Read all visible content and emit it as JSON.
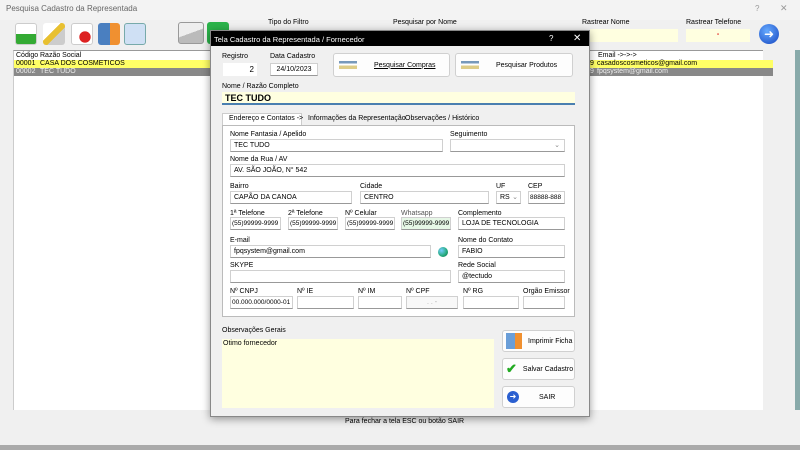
{
  "main_window": {
    "title": "Pesquisa Cadastro da Representada",
    "help": "?",
    "close": "✕",
    "filter_label": "Tipo do Filtro",
    "search_name_label": "Pesquisar por Nome",
    "track_name_label": "Rastrear Nome",
    "track_phone_label": "Rastrear Telefone",
    "track_phone_value": "-",
    "toolbar": [
      "add-icon",
      "edit-icon",
      "delete-icon",
      "print-icon",
      "printer-icon",
      "email-icon",
      "whatsapp-icon"
    ],
    "list": {
      "headers": {
        "code": "Código",
        "name": "Razão Social",
        "email": "Email ->->->"
      },
      "rows": [
        {
          "code": "00001",
          "name": "CASA DOS COSMETICOS",
          "tail": "9",
          "email": "casadoscosmeticos@gmail.com"
        },
        {
          "code": "00002",
          "name": "TEC TUDO",
          "tail": "9",
          "email": "fpqsystem@gmail.com"
        }
      ]
    },
    "footer": "Para fechar a tela ESC ou botão SAIR"
  },
  "dialog": {
    "title": "Tela Cadastro da Representada / Fornecedor",
    "help": "?",
    "close": "✕",
    "registro_label": "Registro",
    "registro": "2",
    "data_label": "Data Cadastro",
    "data": "24/10/2023",
    "btn_compras": "Pesquisar Compras",
    "btn_produtos": "Pesquisar Produtos",
    "nome_label": "Nome / Razão Completo",
    "nome": "TEC TUDO",
    "tabs": [
      "Endereço e Contatos ->",
      "Informações da Representação",
      "Observações / Histórico"
    ],
    "fields": {
      "fantasia_label": "Nome Fantasia / Apelido",
      "fantasia": "TEC TUDO",
      "seguimento_label": "Seguimento",
      "seguimento": "",
      "rua_label": "Nome da Rua / AV",
      "rua": "AV. SÃO JOÃO, N° 542",
      "bairro_label": "Bairro",
      "bairro": "CAPÃO DA CANOA",
      "cidade_label": "Cidade",
      "cidade": "CENTRO",
      "uf_label": "UF",
      "uf": "RS",
      "cep_label": "CEP",
      "cep": "88888-888",
      "tel1_label": "1ª Telefone",
      "tel1": "(55)99999-9999",
      "tel2_label": "2ª Telefone",
      "tel2": "(55)99999-9999",
      "cel_label": "Nº Celular",
      "cel": "(55)99999-9999",
      "whats_label": "Whatsapp",
      "whats": "(55)99999-9999",
      "compl_label": "Complemento",
      "compl": "LOJA DE TECNOLOGIA",
      "email_label": "E-mail",
      "email": "fpqsystem@gmail.com",
      "contato_label": "Nome do Contato",
      "contato": "FABIO",
      "skype_label": "SKYPE",
      "skype": "",
      "rede_label": "Rede Social",
      "rede": "@tectudo",
      "cnpj_label": "Nº CNPJ",
      "cnpj": "00.000.000/0000-01",
      "ie_label": "Nº IE",
      "ie": "",
      "im_label": "Nº IM",
      "im": "",
      "cpf_label": "Nº CPF",
      "cpf": " .   .   -",
      "rg_label": "Nº RG",
      "rg": "",
      "orgao_label": "Orgão Emissor",
      "orgao": ""
    },
    "obs_label": "Observações Gerais",
    "obs": "Otimo fornecedor",
    "btn_imprimir": "Imprimir Ficha",
    "btn_salvar": "Salvar Cadastro",
    "btn_sair": "SAIR"
  }
}
